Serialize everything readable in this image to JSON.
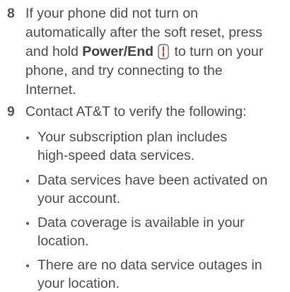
{
  "steps": [
    {
      "number": "8",
      "lines": {
        "l1": "If your phone did not turn on",
        "l2": "automatically after the soft reset, press",
        "l3_pre": "and hold ",
        "l3_key": "Power/End",
        "l3_post": " to turn on your",
        "l4": "phone, and try connecting to the",
        "l5": "Internet."
      },
      "icon": "power-end-key-icon"
    },
    {
      "number": "9",
      "intro": "Contact AT&T to verify the following:",
      "bullets": [
        {
          "l1": "Your subscription plan includes",
          "l2": "high-speed data services."
        },
        {
          "l1": "Data services have been activated on",
          "l2": "your account."
        },
        {
          "l1": "Data coverage is available in your",
          "l2": "location."
        },
        {
          "l1": "There are no data service outages in",
          "l2": "your location."
        }
      ]
    }
  ],
  "colors": {
    "text": "#4a4a4a",
    "icon_accent": "#d12b2b"
  }
}
